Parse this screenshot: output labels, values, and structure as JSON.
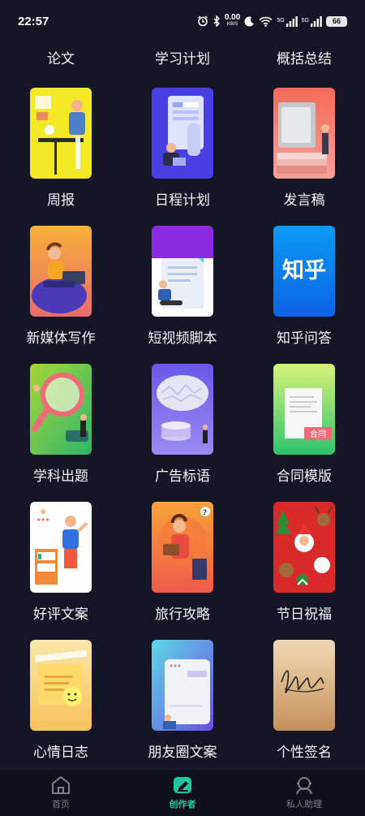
{
  "status_bar": {
    "time": "22:57",
    "net_speed": "0.00",
    "net_unit": "KB/S",
    "sim1": "5G",
    "sim2": "5G",
    "battery": "66",
    "icons": [
      "alarm-icon",
      "bluetooth-icon",
      "moon-icon",
      "wifi-icon",
      "signal-icon",
      "signal-icon"
    ]
  },
  "top_labels": [
    "论文",
    "学习计划",
    "概括总结"
  ],
  "cards": [
    {
      "label": "周报",
      "icon": "weekly-report-illustration"
    },
    {
      "label": "日程计划",
      "icon": "schedule-illustration"
    },
    {
      "label": "发言稿",
      "icon": "speech-illustration"
    },
    {
      "label": "新媒体写作",
      "icon": "new-media-illustration"
    },
    {
      "label": "短视频脚本",
      "icon": "video-script-illustration"
    },
    {
      "label": "知乎问答",
      "icon": "zhihu-logo",
      "logo_text": "知乎"
    },
    {
      "label": "学科出题",
      "icon": "magnifier-illustration"
    },
    {
      "label": "广告标语",
      "icon": "brain-illustration"
    },
    {
      "label": "合同模版",
      "icon": "contract-illustration",
      "badge_text": "合同"
    },
    {
      "label": "好评文案",
      "icon": "review-illustration"
    },
    {
      "label": "旅行攻略",
      "icon": "travel-illustration"
    },
    {
      "label": "节日祝福",
      "icon": "christmas-illustration"
    },
    {
      "label": "心情日志",
      "icon": "mood-note-illustration"
    },
    {
      "label": "朋友圈文案",
      "icon": "moments-illustration"
    },
    {
      "label": "个性签名",
      "icon": "signature-illustration"
    }
  ],
  "bottom_nav": [
    {
      "label": "首页",
      "icon": "home-icon",
      "active": false
    },
    {
      "label": "创作者",
      "icon": "creator-icon",
      "active": true
    },
    {
      "label": "私人助理",
      "icon": "assistant-icon",
      "active": false
    }
  ],
  "colors": {
    "background": "#141625",
    "accent": "#21c6a0",
    "nav_inactive": "#7c7f8f"
  }
}
